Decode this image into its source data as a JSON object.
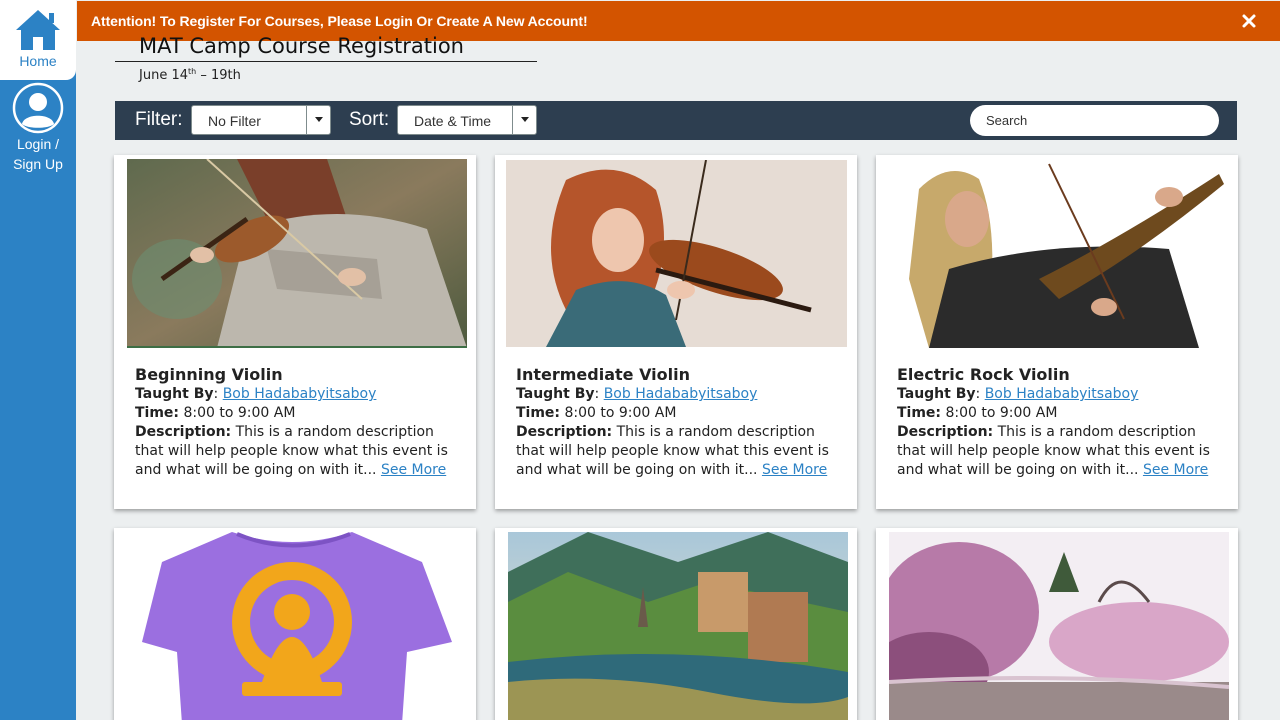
{
  "sidebar": {
    "home_label": "Home",
    "login_label_line1": "Login /",
    "login_label_line2": "Sign Up"
  },
  "banner": {
    "message": "Attention! To Register For Courses, Please Login Or Create A New Account!",
    "close_icon": "close-icon",
    "color": "#d35400"
  },
  "page": {
    "title": "MAT Camp Course Registration",
    "dates_prefix": "June 14",
    "dates_sup": "th",
    "dates_suffix": " – 19th"
  },
  "toolbar": {
    "filter_label": "Filter:",
    "filter_value": "No Filter",
    "sort_label": "Sort:",
    "sort_value": "Date & Time",
    "search_placeholder": "Search"
  },
  "courses": [
    {
      "title": "Beginning Violin",
      "taught_by_label": "Taught By",
      "instructor": "Bob Hadababyitsaboy",
      "time_label": "Time:",
      "time": "8:00 to 9:00 AM",
      "description_label": "Description:",
      "description": "This is a random description that will help people know what this event is and what will be going on with it...",
      "see_more": "See More",
      "image": "woman playing violin in grey sweater"
    },
    {
      "title": "Intermediate Violin",
      "taught_by_label": "Taught By",
      "instructor": "Bob Hadababyitsaboy",
      "time_label": "Time:",
      "time": "8:00 to 9:00 AM",
      "description_label": "Description:",
      "description": "This is a random description that will help people know what this event is and what will be going on with it...",
      "see_more": "See More",
      "image": "red-haired violinist"
    },
    {
      "title": "Electric Rock Violin",
      "taught_by_label": "Taught By",
      "instructor": "Bob Hadababyitsaboy",
      "time_label": "Time:",
      "time": "8:00 to 9:00 AM",
      "description_label": "Description:",
      "description": "This is a random description that will help people know what this event is and what will be going on with it...",
      "see_more": "See More",
      "image": "long-haired man playing electric violin"
    },
    {
      "image": "purple t-shirt with orange graphic"
    },
    {
      "image": "watercolor mountain village"
    },
    {
      "image": "watercolor cherry blossom trees"
    }
  ],
  "colors": {
    "sidebar": "#2c82c5",
    "toolbar": "#2d3e50",
    "link": "#2c82c5"
  }
}
